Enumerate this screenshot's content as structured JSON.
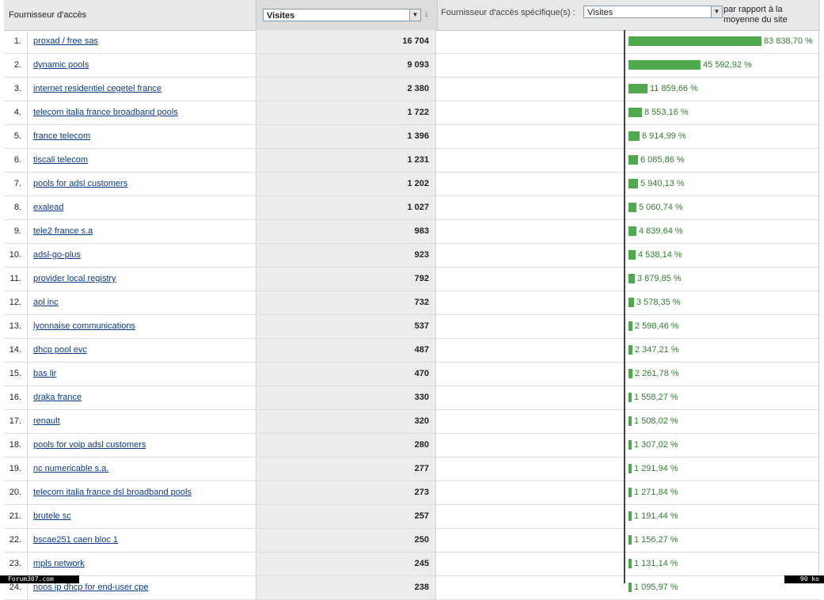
{
  "header": {
    "dimension_label": "Fournisseur d'accès",
    "metric_select": {
      "value": "Visites"
    },
    "sort_icon": "sort-down-arrow-icon",
    "comparison_label": "Fournisseur d'accès spécifique(s) :",
    "comparison_select": {
      "value": "Visites"
    },
    "relative_label": "par rapport à la moyenne du site"
  },
  "colors": {
    "bar": "#4fa94f",
    "percent_text": "#2f7f2f",
    "link": "#0b3b8c"
  },
  "rows": [
    {
      "index": "1.",
      "name": "proxad / free sas",
      "visits": "16 704",
      "pct": "83 838,70 %",
      "ratio": 83838.7
    },
    {
      "index": "2.",
      "name": "dynamic pools",
      "visits": "9 093",
      "pct": "45 592,92 %",
      "ratio": 45592.92
    },
    {
      "index": "3.",
      "name": "internet residentiel cegetel france",
      "visits": "2 380",
      "pct": "11 859,66 %",
      "ratio": 11859.66
    },
    {
      "index": "4.",
      "name": "telecom italia france broadband pools",
      "visits": "1 722",
      "pct": "8 553,16 %",
      "ratio": 8553.16
    },
    {
      "index": "5.",
      "name": "france telecom",
      "visits": "1 396",
      "pct": "6 914,99 %",
      "ratio": 6914.99
    },
    {
      "index": "6.",
      "name": "tiscali telecom",
      "visits": "1 231",
      "pct": "6 085,86 %",
      "ratio": 6085.86
    },
    {
      "index": "7.",
      "name": "pools for adsl customers",
      "visits": "1 202",
      "pct": "5 940,13 %",
      "ratio": 5940.13
    },
    {
      "index": "8.",
      "name": "exalead",
      "visits": "1 027",
      "pct": "5 060,74 %",
      "ratio": 5060.74
    },
    {
      "index": "9.",
      "name": "tele2 france s.a",
      "visits": "983",
      "pct": "4 839,64 %",
      "ratio": 4839.64
    },
    {
      "index": "10.",
      "name": "adsl-go-plus",
      "visits": "923",
      "pct": "4 538,14 %",
      "ratio": 4538.14
    },
    {
      "index": "11.",
      "name": "provider local registry",
      "visits": "792",
      "pct": "3 879,85 %",
      "ratio": 3879.85
    },
    {
      "index": "12.",
      "name": "aol inc",
      "visits": "732",
      "pct": "3 578,35 %",
      "ratio": 3578.35
    },
    {
      "index": "13.",
      "name": "lyonnaise communications",
      "visits": "537",
      "pct": "2 598,46 %",
      "ratio": 2598.46
    },
    {
      "index": "14.",
      "name": "dhcp pool evc",
      "visits": "487",
      "pct": "2 347,21 %",
      "ratio": 2347.21
    },
    {
      "index": "15.",
      "name": "bas lir",
      "visits": "470",
      "pct": "2 261,78 %",
      "ratio": 2261.78
    },
    {
      "index": "16.",
      "name": "draka france",
      "visits": "330",
      "pct": "1 558,27 %",
      "ratio": 1558.27
    },
    {
      "index": "17.",
      "name": "renault",
      "visits": "320",
      "pct": "1 508,02 %",
      "ratio": 1508.02
    },
    {
      "index": "18.",
      "name": "pools for voip adsl customers",
      "visits": "280",
      "pct": "1 307,02 %",
      "ratio": 1307.02
    },
    {
      "index": "19.",
      "name": "nc numericable s.a.",
      "visits": "277",
      "pct": "1 291,94 %",
      "ratio": 1291.94
    },
    {
      "index": "20.",
      "name": "telecom italia france dsl broadband pools",
      "visits": "273",
      "pct": "1 271,84 %",
      "ratio": 1271.84
    },
    {
      "index": "21.",
      "name": "brutele sc",
      "visits": "257",
      "pct": "1 191,44 %",
      "ratio": 1191.44
    },
    {
      "index": "22.",
      "name": "bscae251 caen bloc 1",
      "visits": "250",
      "pct": "1 156,27 %",
      "ratio": 1156.27
    },
    {
      "index": "23.",
      "name": "mpls network",
      "visits": "245",
      "pct": "1 131,14 %",
      "ratio": 1131.14
    },
    {
      "index": "24.",
      "name": "noos ip dhcp for end-user cpe",
      "visits": "238",
      "pct": "1 095,97 %",
      "ratio": 1095.97
    }
  ],
  "watermark": {
    "left": "Forum307.com",
    "right": "90 ko"
  }
}
